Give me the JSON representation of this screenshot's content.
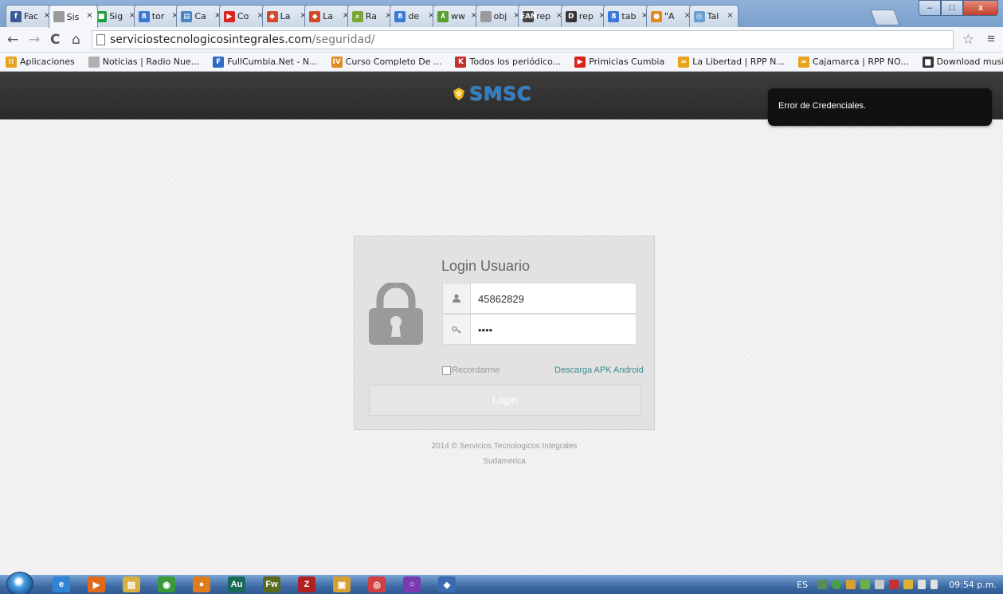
{
  "browser": {
    "tabs": [
      {
        "label": "Fac",
        "color": "#3b5998",
        "glyph": "f"
      },
      {
        "label": "Sis",
        "color": "#9a9a9a",
        "glyph": "",
        "active": true
      },
      {
        "label": "Sig",
        "color": "#1e9b3a",
        "glyph": "■"
      },
      {
        "label": "tor",
        "color": "#3c78d8",
        "glyph": "8"
      },
      {
        "label": "Ca",
        "color": "#4a86c5",
        "glyph": "▤"
      },
      {
        "label": "Co",
        "color": "#d9241c",
        "glyph": "▶"
      },
      {
        "label": "La",
        "color": "#d24a2a",
        "glyph": "◆"
      },
      {
        "label": "La",
        "color": "#d24a2a",
        "glyph": "◆"
      },
      {
        "label": "Ra",
        "color": "#7aa63a",
        "glyph": "⌕"
      },
      {
        "label": "de",
        "color": "#3c78d8",
        "glyph": "8"
      },
      {
        "label": "ww",
        "color": "#5aa02c",
        "glyph": "ʎ"
      },
      {
        "label": "obj",
        "color": "#9a9a9a",
        "glyph": ""
      },
      {
        "label": "rep",
        "color": "#444444",
        "glyph": "EAN"
      },
      {
        "label": "rep",
        "color": "#333333",
        "glyph": "D"
      },
      {
        "label": "tab",
        "color": "#3c78d8",
        "glyph": "8"
      },
      {
        "label": "\"A",
        "color": "#e08a1e",
        "glyph": "●"
      },
      {
        "label": "Tal",
        "color": "#6a9ed0",
        "glyph": "◎"
      }
    ],
    "window_buttons": {
      "minimize": "–",
      "maximize": "□",
      "close": "x"
    },
    "nav": {
      "back": "←",
      "forward": "→",
      "reload": "C",
      "home": "⌂"
    },
    "url_host": "serviciostecnologicosintegrales.com",
    "url_path": "/seguridad/",
    "star": "☆",
    "menu": "≡",
    "bookmarks": [
      {
        "label": "Aplicaciones",
        "color": "#e8a31c",
        "glyph": "⁝⁝"
      },
      {
        "label": "Noticias | Radio Nue...",
        "color": "#b0b0b0",
        "glyph": ""
      },
      {
        "label": "FullCumbia.Net - N...",
        "color": "#2d6bc4",
        "glyph": "F"
      },
      {
        "label": "Curso Completo De ...",
        "color": "#e08a1e",
        "glyph": "IV"
      },
      {
        "label": "Todos los periódico...",
        "color": "#c4302b",
        "glyph": "K"
      },
      {
        "label": "Primicias Cumbia",
        "color": "#d9241c",
        "glyph": "▶"
      },
      {
        "label": "La Libertad | RPP N...",
        "color": "#e8a31c",
        "glyph": "∞"
      },
      {
        "label": "Cajamarca | RPP NO...",
        "color": "#e8a31c",
        "glyph": "∞"
      },
      {
        "label": "Download music, m...",
        "color": "#333333",
        "glyph": "▆"
      }
    ]
  },
  "site": {
    "logo_text": "SMSC",
    "toast": "Error de Credenciales.",
    "login": {
      "title": "Login Usuario",
      "user_icon": "user-icon",
      "key_icon": "key-icon",
      "username_value": "45862829",
      "password_value": "••••",
      "remember_label": "Recordarme",
      "apk_link": "Descarga APK Android",
      "button_label": "Login"
    },
    "footer_line1": "2014 © Servicios Tecnologicos Integrales",
    "footer_line2": "Sudamerica"
  },
  "taskbar": {
    "language": "ES",
    "clock": "09:54 p.m.",
    "apps": [
      {
        "name": "ie-icon",
        "color": "#2f84d4",
        "glyph": "e"
      },
      {
        "name": "media-icon",
        "color": "#e06a1a",
        "glyph": "▶"
      },
      {
        "name": "explorer-icon",
        "color": "#d8b040",
        "glyph": "▤"
      },
      {
        "name": "chrome-icon",
        "color": "#3a9a3a",
        "glyph": "◉"
      },
      {
        "name": "firefox-icon",
        "color": "#e07a1a",
        "glyph": "●"
      },
      {
        "name": "audition-icon",
        "color": "#1a6a5a",
        "glyph": "Au"
      },
      {
        "name": "fireworks-icon",
        "color": "#5a6a1a",
        "glyph": "Fw"
      },
      {
        "name": "filezilla-icon",
        "color": "#b02020",
        "glyph": "Z"
      },
      {
        "name": "folder-icon",
        "color": "#d8a030",
        "glyph": "▣"
      },
      {
        "name": "app-icon",
        "color": "#d04040",
        "glyph": "◎"
      },
      {
        "name": "circle-app-icon",
        "color": "#7a3ab0",
        "glyph": "○"
      },
      {
        "name": "shield-app-icon",
        "color": "#3a6ab0",
        "glyph": "◆"
      }
    ]
  }
}
